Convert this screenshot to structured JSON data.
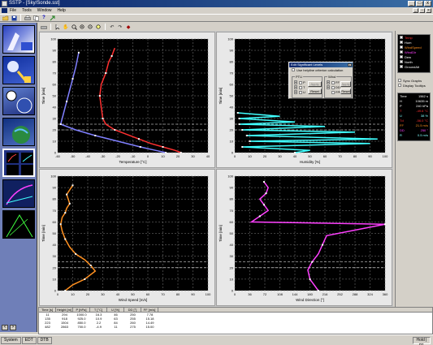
{
  "window": {
    "title": "SSTP - [Sky/Sonde.sst]",
    "menu": [
      "File",
      "Tools",
      "Window",
      "Help"
    ],
    "buttons": [
      "_",
      "□",
      "x"
    ]
  },
  "toolbar": {
    "icons": [
      "open-folder-icon",
      "save-icon",
      "print-icon",
      "copy-icon",
      "help-icon",
      "export-icon"
    ]
  },
  "left_nav": {
    "thumbnails": [
      "sonde-launch",
      "balloon-release",
      "wind-rose",
      "globe-map",
      "profile-charts",
      "trajectory",
      "ray-trace"
    ],
    "nav_buttons": [
      "<",
      ">"
    ]
  },
  "chart_toolbar": {
    "icons": [
      "print-icon",
      "cursor-icon",
      "hand-icon",
      "zoom-icon",
      "zoom-in-icon",
      "zoom-out-icon",
      "zoom-fit-icon",
      "undo-icon",
      "redo-icon",
      "settings-icon"
    ]
  },
  "dialog": {
    "title": "Edit Significant Levels",
    "checkbox_label": "Use helpline criterion calculation",
    "group_ptu": "PTU",
    "group_wind": "Wind",
    "ptu_rows": [
      "P",
      "T",
      "U"
    ],
    "wind_rows": [
      "FF",
      "DD"
    ],
    "apply_label": "Apply",
    "reset_label": "Reset",
    "wind_apply_label": "Apply",
    "wind_reset_label": "Reset",
    "fpu_label": "FPU"
  },
  "right_panel": {
    "legend": [
      {
        "label": "Temp",
        "color": "#ff3030"
      },
      {
        "label": "Hum",
        "color": "#ffffff"
      },
      {
        "label": "WindSpeed",
        "color": "#ff9020"
      },
      {
        "label": "WindDir",
        "color": "#ff40ff"
      },
      {
        "label": "Dew",
        "color": "#ffffff"
      },
      {
        "label": "North",
        "color": "#ffffff"
      },
      {
        "label": "GroundAlt",
        "color": "#ffffff"
      }
    ],
    "options": [
      "Sync Graphs",
      "Display Tooltips"
    ],
    "info": [
      {
        "k": "Time",
        "v": "1562 s",
        "color": "#ffffff"
      },
      {
        "k": "H",
        "v": "10635 m",
        "color": "#ffffff"
      },
      {
        "k": "P",
        "v": "240 hPa",
        "color": "#ffffff"
      },
      {
        "k": "T",
        "v": "-49.6 °C",
        "color": "#ff3030"
      },
      {
        "k": "U",
        "v": "38 %",
        "color": "#80ffff"
      },
      {
        "k": "Td",
        "v": "-56.0 °C",
        "color": "#ff3030"
      },
      {
        "k": "FF",
        "v": "21.5 m/s",
        "color": "#ff9020"
      },
      {
        "k": "DD",
        "v": "250 °",
        "color": "#ff40ff"
      },
      {
        "k": "R",
        "v": "0.5 m/s",
        "color": "#80ffff"
      }
    ]
  },
  "table": {
    "headers": [
      "Time [s]",
      "Height [m]",
      "P [hPa]",
      "T [°C]",
      "U [%]",
      "DD [°]",
      "FF [m/s]"
    ],
    "rows": [
      [
        "11",
        "294",
        "1000.0",
        "16.3",
        "46",
        "250",
        "7.78"
      ],
      [
        "135",
        "918",
        "925.0",
        "10.9",
        "63",
        "255",
        "15.18"
      ],
      [
        "223",
        "1504",
        "850.0",
        "2.2",
        "84",
        "260",
        "14.49"
      ],
      [
        "482",
        "2863",
        "700.0",
        "-4.9",
        "11",
        "275",
        "15.00"
      ]
    ]
  },
  "status": {
    "tabs": [
      "System",
      "EDT",
      "DTB"
    ],
    "right": "Hold | P1"
  },
  "chart_data": [
    {
      "type": "line",
      "title": "",
      "xlabel": "Temperature [°C]",
      "ylabel": "Time [min]",
      "xlim": [
        -60,
        40
      ],
      "ylim": [
        0,
        100
      ],
      "x_ticks": [
        "-60",
        "-50",
        "-40",
        "-30",
        "-20",
        "-10",
        "0",
        "10",
        "20",
        "30",
        "40"
      ],
      "y_ticks": [
        "0",
        "10",
        "20",
        "30",
        "40",
        "50",
        "60",
        "70",
        "80",
        "90",
        "100"
      ],
      "series": [
        {
          "color": "#ff3030",
          "x": [
            22,
            18,
            10,
            2,
            -6,
            -14,
            -22,
            -28,
            -30,
            -31,
            -32,
            -31,
            -28,
            -26,
            -24,
            -22
          ],
          "y": [
            0,
            2,
            5,
            8,
            12,
            16,
            20,
            25,
            30,
            40,
            50,
            60,
            70,
            80,
            85,
            92
          ]
        },
        {
          "color": "#8080ff",
          "x": [
            12,
            5,
            -5,
            -20,
            -35,
            -48,
            -58,
            -56,
            -54,
            -52,
            -50,
            -48,
            -46
          ],
          "y": [
            0,
            2,
            5,
            10,
            15,
            20,
            25,
            35,
            45,
            55,
            65,
            75,
            88
          ]
        }
      ]
    },
    {
      "type": "line",
      "title": "",
      "xlabel": "Humidity [%]",
      "ylabel": "Time [min]",
      "xlim": [
        0,
        100
      ],
      "ylim": [
        0,
        100
      ],
      "x_ticks": [
        "0",
        "10",
        "20",
        "30",
        "40",
        "50",
        "60",
        "70",
        "80",
        "90",
        "100"
      ],
      "y_ticks": [
        "0",
        "10",
        "20",
        "30",
        "40",
        "50",
        "60",
        "70",
        "80",
        "90",
        "100"
      ],
      "series": [
        {
          "color": "#40ffff",
          "x": [
            40,
            50,
            5,
            90,
            10,
            95,
            8,
            80,
            5,
            60,
            3,
            40,
            3,
            30,
            2
          ],
          "y": [
            0,
            2,
            5,
            8,
            10,
            12,
            15,
            18,
            20,
            23,
            25,
            27,
            30,
            32,
            35
          ]
        }
      ]
    },
    {
      "type": "line",
      "title": "",
      "xlabel": "Wind Speed [m/s]",
      "ylabel": "Time [min]",
      "xlim": [
        0,
        100
      ],
      "ylim": [
        0,
        100
      ],
      "x_ticks": [
        "0",
        "10",
        "20",
        "30",
        "40",
        "50",
        "60",
        "70",
        "80",
        "90",
        "100"
      ],
      "y_ticks": [
        "0",
        "10",
        "20",
        "30",
        "40",
        "50",
        "60",
        "70",
        "80",
        "90",
        "100"
      ],
      "series": [
        {
          "color": "#ff9020",
          "x": [
            5,
            10,
            18,
            25,
            22,
            18,
            12,
            8,
            5,
            3,
            2,
            3,
            5,
            6,
            8,
            7,
            6,
            8,
            10
          ],
          "y": [
            0,
            5,
            10,
            17,
            22,
            27,
            32,
            38,
            45,
            52,
            58,
            64,
            68,
            72,
            76,
            80,
            84,
            88,
            92
          ]
        }
      ]
    },
    {
      "type": "line",
      "title": "",
      "xlabel": "Wind Direction [°]",
      "ylabel": "Time [min]",
      "xlim": [
        0,
        360
      ],
      "ylim": [
        0,
        100
      ],
      "x_ticks": [
        "0",
        "36",
        "72",
        "108",
        "144",
        "180",
        "216",
        "252",
        "288",
        "324",
        "360"
      ],
      "y_ticks": [
        "0",
        "10",
        "20",
        "30",
        "40",
        "50",
        "60",
        "70",
        "80",
        "90",
        "100"
      ],
      "series": [
        {
          "color": "#ff40ff",
          "x": [
            200,
            190,
            180,
            175,
            185,
            200,
            210,
            220,
            360,
            40,
            60,
            80,
            70,
            60,
            75,
            80,
            70
          ],
          "y": [
            0,
            5,
            10,
            18,
            25,
            32,
            40,
            48,
            58,
            60,
            65,
            70,
            75,
            80,
            85,
            90,
            95
          ]
        }
      ]
    }
  ]
}
